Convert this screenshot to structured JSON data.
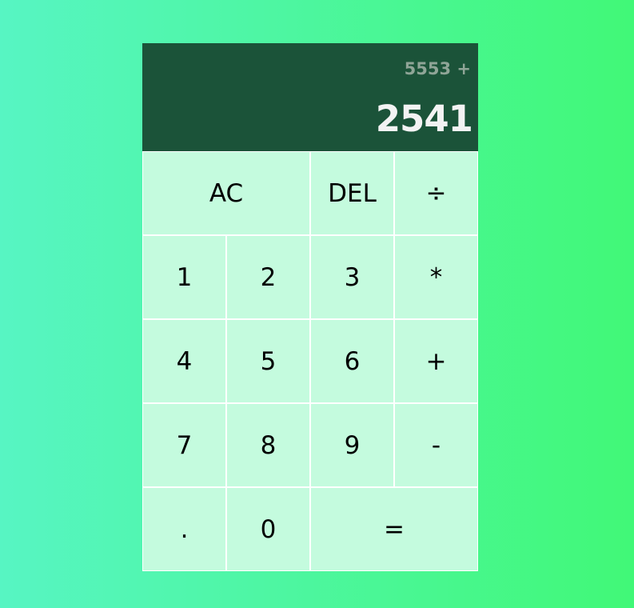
{
  "display": {
    "previous_operand": "5553 +",
    "current_operand": "2541"
  },
  "keys": {
    "all_clear": "AC",
    "delete": "DEL",
    "divide": "÷",
    "one": "1",
    "two": "2",
    "three": "3",
    "multiply": "*",
    "four": "4",
    "five": "5",
    "six": "6",
    "add": "+",
    "seven": "7",
    "eight": "8",
    "nine": "9",
    "subtract": "-",
    "decimal": ".",
    "zero": "0",
    "equals": "="
  },
  "colors": {
    "background_left": "#57f5c3",
    "background_right": "#41f877",
    "display_bg": "#1b5339",
    "key_bg": "#c4fbde",
    "previous_text": "#8fa597",
    "current_text": "#f3f3f3"
  }
}
